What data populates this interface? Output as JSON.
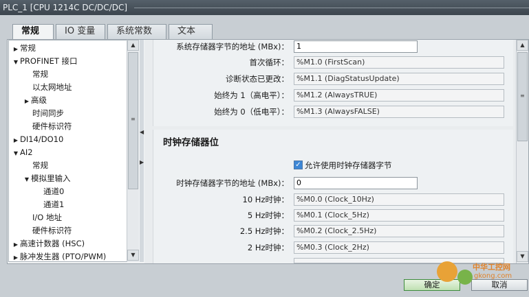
{
  "window": {
    "title": "PLC_1 [CPU 1214C DC/DC/DC]"
  },
  "tabs": [
    {
      "label": "常规",
      "active": true
    },
    {
      "label": "IO 变量",
      "active": false
    },
    {
      "label": "系统常数",
      "active": false
    },
    {
      "label": "文本",
      "active": false
    }
  ],
  "tree": {
    "items": [
      {
        "label": "常规",
        "arrow": "▶"
      },
      {
        "label": "PROFINET 接口",
        "arrow": "▼"
      },
      {
        "label": "常规",
        "arrow": ""
      },
      {
        "label": "以太网地址",
        "arrow": ""
      },
      {
        "label": "高级",
        "arrow": "▶"
      },
      {
        "label": "时间同步",
        "arrow": ""
      },
      {
        "label": "硬件标识符",
        "arrow": ""
      },
      {
        "label": "DI14/DO10",
        "arrow": "▶"
      },
      {
        "label": "AI2",
        "arrow": "▼"
      },
      {
        "label": "常规",
        "arrow": ""
      },
      {
        "label": "模拟里输入",
        "arrow": "▼"
      },
      {
        "label": "通道0",
        "arrow": ""
      },
      {
        "label": "通道1",
        "arrow": ""
      },
      {
        "label": "I/O 地址",
        "arrow": ""
      },
      {
        "label": "硬件标识符",
        "arrow": ""
      },
      {
        "label": "高速计数器 (HSC)",
        "arrow": "▶"
      },
      {
        "label": "脉冲发生器 (PTO/PWM)",
        "arrow": "▶"
      }
    ]
  },
  "system_memory": {
    "address_label": "系统存储器字节的地址 (MBx)：",
    "address_value": "1",
    "rows": [
      {
        "label": "首次循环：",
        "value": "%M1.0 (FirstScan)"
      },
      {
        "label": "诊断状态已更改：",
        "value": "%M1.1 (DiagStatusUpdate)"
      },
      {
        "label": "始终为 1（高电平）：",
        "value": "%M1.2 (AlwaysTRUE)"
      },
      {
        "label": "始终为 0（低电平）：",
        "value": "%M1.3 (AlwaysFALSE)"
      }
    ]
  },
  "clock_memory": {
    "title": "时钟存储器位",
    "enable_label": "允许使用时钟存储器字节",
    "enabled": true,
    "address_label": "时钟存储器字节的地址 (MBx)：",
    "address_value": "0",
    "rows": [
      {
        "label": "10 Hz时钟：",
        "value": "%M0.0 (Clock_10Hz)"
      },
      {
        "label": "5 Hz时钟：",
        "value": "%M0.1 (Clock_5Hz)"
      },
      {
        "label": "2.5 Hz时钟：",
        "value": "%M0.2 (Clock_2.5Hz)"
      },
      {
        "label": "2 Hz时钟：",
        "value": "%M0.3 (Clock_2Hz)"
      }
    ]
  },
  "buttons": {
    "ok": "确定",
    "cancel": "取消"
  },
  "watermark": {
    "line1": "中华工控网",
    "line2": "gkong.com"
  }
}
